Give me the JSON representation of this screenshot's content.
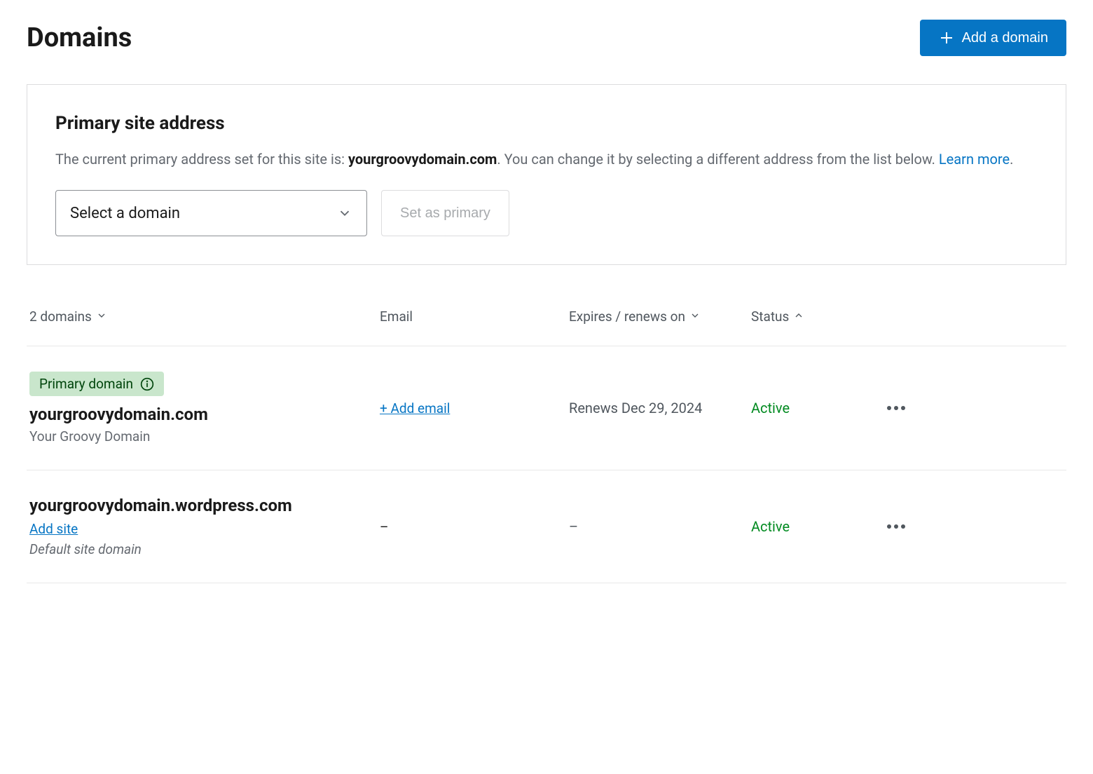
{
  "header": {
    "title": "Domains",
    "add_button_label": "Add a domain"
  },
  "primary_panel": {
    "title": "Primary site address",
    "desc_prefix": "The current primary address set for this site is: ",
    "desc_domain": "yourgroovydomain.com",
    "desc_suffix": ". You can change it by selecting a different address from the list below. ",
    "learn_more": "Learn more",
    "desc_end": ".",
    "select_placeholder": "Select a domain",
    "set_primary_label": "Set as primary"
  },
  "table": {
    "headers": {
      "domains": "2 domains",
      "email": "Email",
      "expires": "Expires / renews on",
      "status": "Status"
    },
    "rows": [
      {
        "primary_badge": "Primary domain",
        "name": "yourgroovydomain.com",
        "subtitle": "Your Groovy Domain",
        "email_label": "+ Add email",
        "expires": "Renews Dec 29, 2024",
        "status": "Active"
      },
      {
        "name": "yourgroovydomain.wordpress.com",
        "add_site": "Add site",
        "subtitle": "Default site domain",
        "email_label": "–",
        "expires": "–",
        "status": "Active"
      }
    ]
  }
}
